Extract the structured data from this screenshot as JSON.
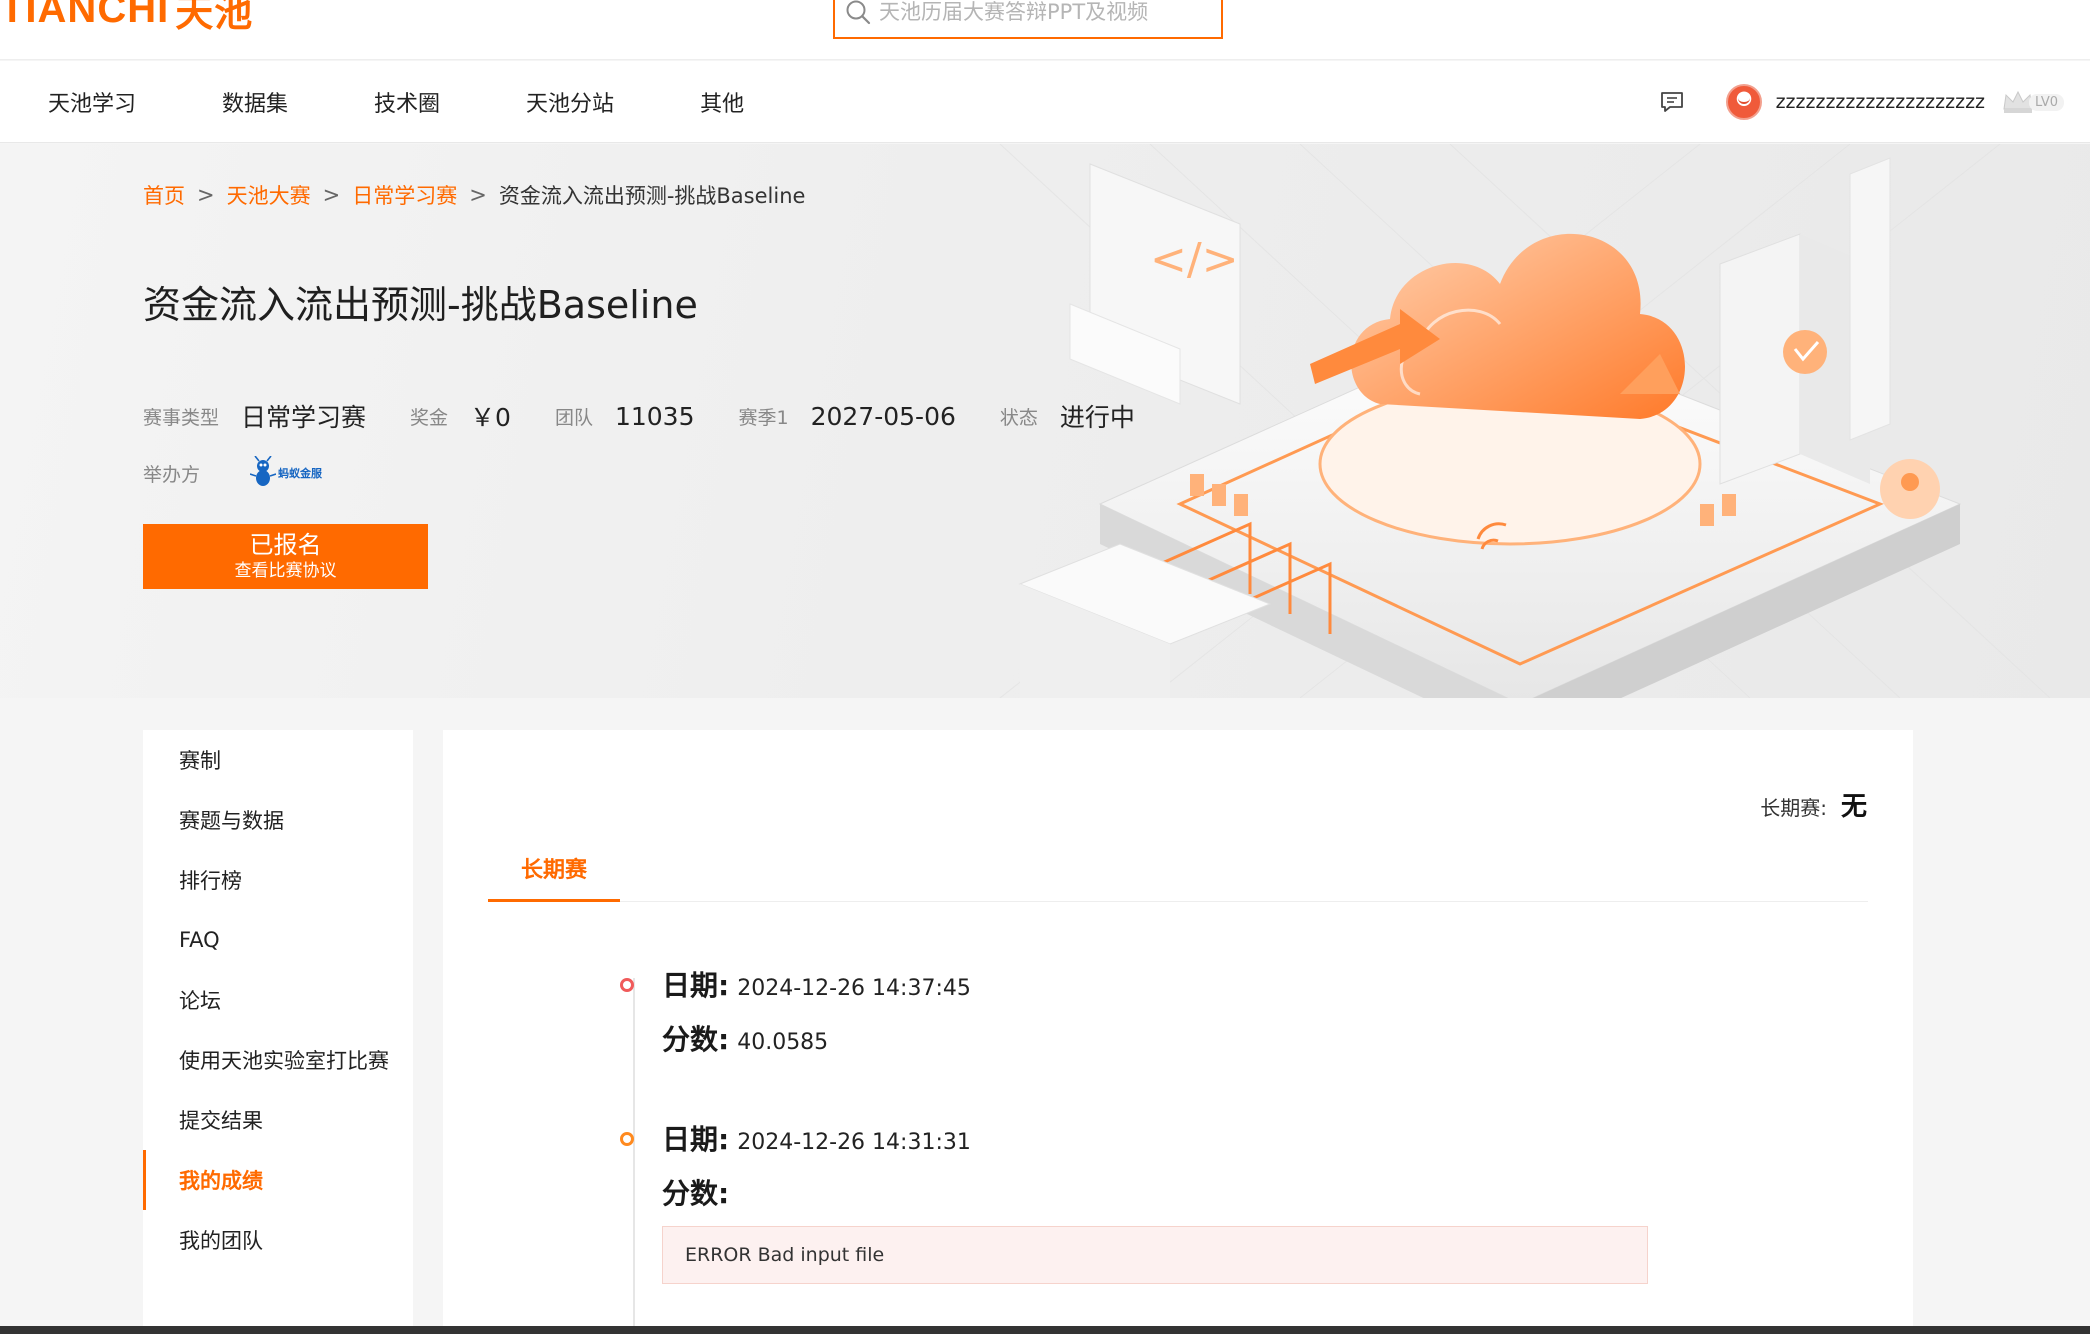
{
  "header": {
    "logo_text": "TIANCHI",
    "logo_cn": "天池",
    "search_placeholder": "天池历届大赛答辩PPT及视频"
  },
  "nav": {
    "items": [
      "天池学习",
      "数据集",
      "技术圈",
      "天池分站",
      "其他"
    ],
    "username": "zzzzzzzzzzzzzzzzzzzzz",
    "level": "LV0"
  },
  "breadcrumb": {
    "items": [
      "首页",
      "天池大赛",
      "日常学习赛"
    ],
    "separator": ">",
    "current": "资金流入流出预测-挑战Baseline"
  },
  "competition": {
    "title": "资金流入流出预测-挑战Baseline",
    "meta": [
      {
        "label": "赛事类型",
        "value": "日常学习赛"
      },
      {
        "label": "奖金",
        "value": "￥0"
      },
      {
        "label": "团队",
        "value": "11035"
      },
      {
        "label": "赛季1",
        "value": "2027-05-06"
      },
      {
        "label": "状态",
        "value": "进行中"
      }
    ],
    "organizer_label": "举办方",
    "organizer_logo_text": "蚂蚁金服",
    "signup_main": "已报名",
    "signup_sub": "查看比赛协议"
  },
  "sidebar": {
    "items": [
      "赛制",
      "赛题与数据",
      "排行榜",
      "FAQ",
      "论坛",
      "使用天池实验室打比赛",
      "提交结果",
      "我的成绩",
      "我的团队"
    ],
    "active_index": 7
  },
  "main": {
    "long_term_label": "长期赛:",
    "long_term_value": "无",
    "tab_label": "长期赛",
    "entries": [
      {
        "date_key": "日期:",
        "date": "2024-12-26 14:37:45",
        "score_key": "分数:",
        "score": "40.0585",
        "dot_color": "#f05a5a"
      },
      {
        "date_key": "日期:",
        "date": "2024-12-26 14:31:31",
        "score_key": "分数:",
        "score": "",
        "error": "ERROR Bad input file",
        "dot_color": "#ff8a1f"
      }
    ]
  },
  "colors": {
    "accent": "#ff6a00",
    "error_bg": "#fdf1f0"
  }
}
